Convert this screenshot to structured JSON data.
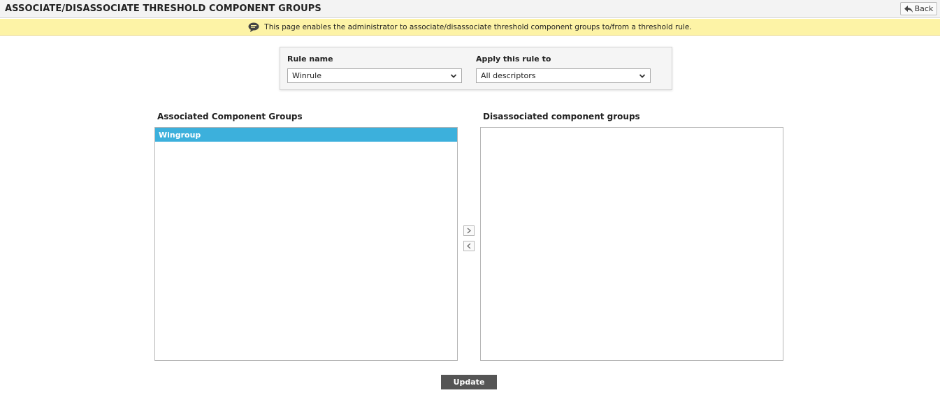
{
  "header": {
    "title": "ASSOCIATE/DISASSOCIATE THRESHOLD COMPONENT GROUPS",
    "back_label": "Back"
  },
  "info": {
    "message": "This page enables the administrator to associate/disassociate threshold component groups to/from a threshold rule.",
    "icon": "speech-bubble-icon"
  },
  "rule": {
    "rule_name_label": "Rule name",
    "rule_name_value": "Winrule",
    "apply_label": "Apply this rule to",
    "apply_value": "All descriptors"
  },
  "associated": {
    "label": "Associated Component Groups",
    "items": [
      "Wingroup"
    ]
  },
  "disassociated": {
    "label": "Disassociated component groups",
    "items": []
  },
  "actions": {
    "update_label": "Update"
  },
  "colors": {
    "selected_item": "#3cb0dc",
    "info_bar": "#fdf3a6",
    "update_button": "#555555"
  }
}
